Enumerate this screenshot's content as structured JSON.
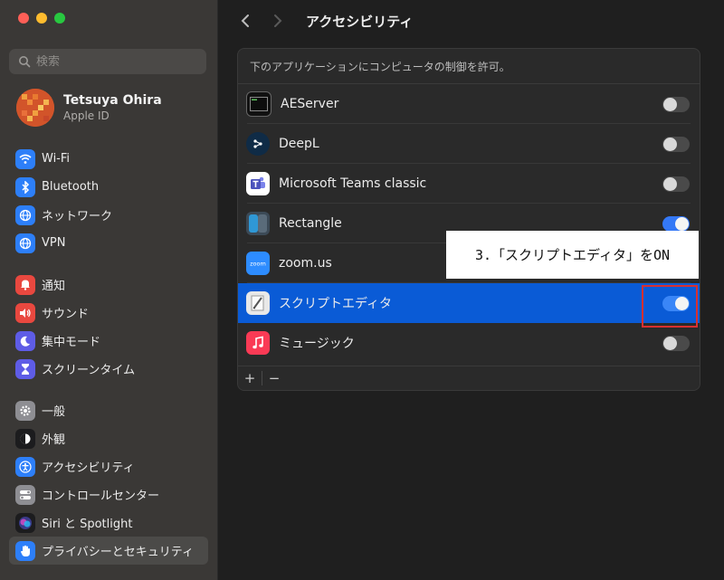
{
  "sidebar": {
    "search_placeholder": "検索",
    "profile": {
      "name": "Tetsuya Ohira",
      "subtitle": "Apple ID"
    },
    "group1": [
      {
        "label": "Wi-Fi",
        "icon": "wifi-icon",
        "color": "#2d7ff9"
      },
      {
        "label": "Bluetooth",
        "icon": "bluetooth-icon",
        "color": "#2d7ff9"
      },
      {
        "label": "ネットワーク",
        "icon": "globe-icon",
        "color": "#2d7ff9"
      },
      {
        "label": "VPN",
        "icon": "vpn-globe-icon",
        "color": "#2d7ff9"
      }
    ],
    "group2": [
      {
        "label": "通知",
        "icon": "bell-icon",
        "color": "#e9483f"
      },
      {
        "label": "サウンド",
        "icon": "speaker-icon",
        "color": "#e9483f"
      },
      {
        "label": "集中モード",
        "icon": "moon-icon",
        "color": "#5e5ce6"
      },
      {
        "label": "スクリーンタイム",
        "icon": "hourglass-icon",
        "color": "#5e5ce6"
      }
    ],
    "group3": [
      {
        "label": "一般",
        "icon": "gear-icon",
        "color": "#8e8e93"
      },
      {
        "label": "外観",
        "icon": "appearance-icon",
        "color": "#1c1c1e"
      },
      {
        "label": "アクセシビリティ",
        "icon": "accessibility-icon",
        "color": "#2d7ff9"
      },
      {
        "label": "コントロールセンター",
        "icon": "switches-icon",
        "color": "#8e8e93"
      },
      {
        "label": "Siri と Spotlight",
        "icon": "siri-icon",
        "color": "#1c1c1e"
      },
      {
        "label": "プライバシーとセキュリティ",
        "icon": "hand-icon",
        "color": "#2d7ff9"
      }
    ]
  },
  "header": {
    "title": "アクセシビリティ"
  },
  "panel": {
    "description": "下のアプリケーションにコンピュータの制御を許可。",
    "apps": [
      {
        "name": "AEServer",
        "icon": "terminal-icon",
        "on": false
      },
      {
        "name": "DeepL",
        "icon": "deepl-icon",
        "on": false
      },
      {
        "name": "Microsoft Teams classic",
        "icon": "teams-icon",
        "on": false
      },
      {
        "name": "Rectangle",
        "icon": "rectangle-icon",
        "on": true
      },
      {
        "name": "zoom.us",
        "icon": "zoom-icon",
        "on": false
      },
      {
        "name": "スクリプトエディタ",
        "icon": "script-editor-icon",
        "on": true
      },
      {
        "name": "ミュージック",
        "icon": "music-icon",
        "on": false
      }
    ],
    "add_label": "+",
    "remove_label": "−"
  },
  "annotation": {
    "text": "3.「スクリプトエディタ」をON"
  },
  "colors": {
    "accent": "#3478f6",
    "highlight": "#0a5bd6",
    "annotation_border": "#d83030"
  }
}
